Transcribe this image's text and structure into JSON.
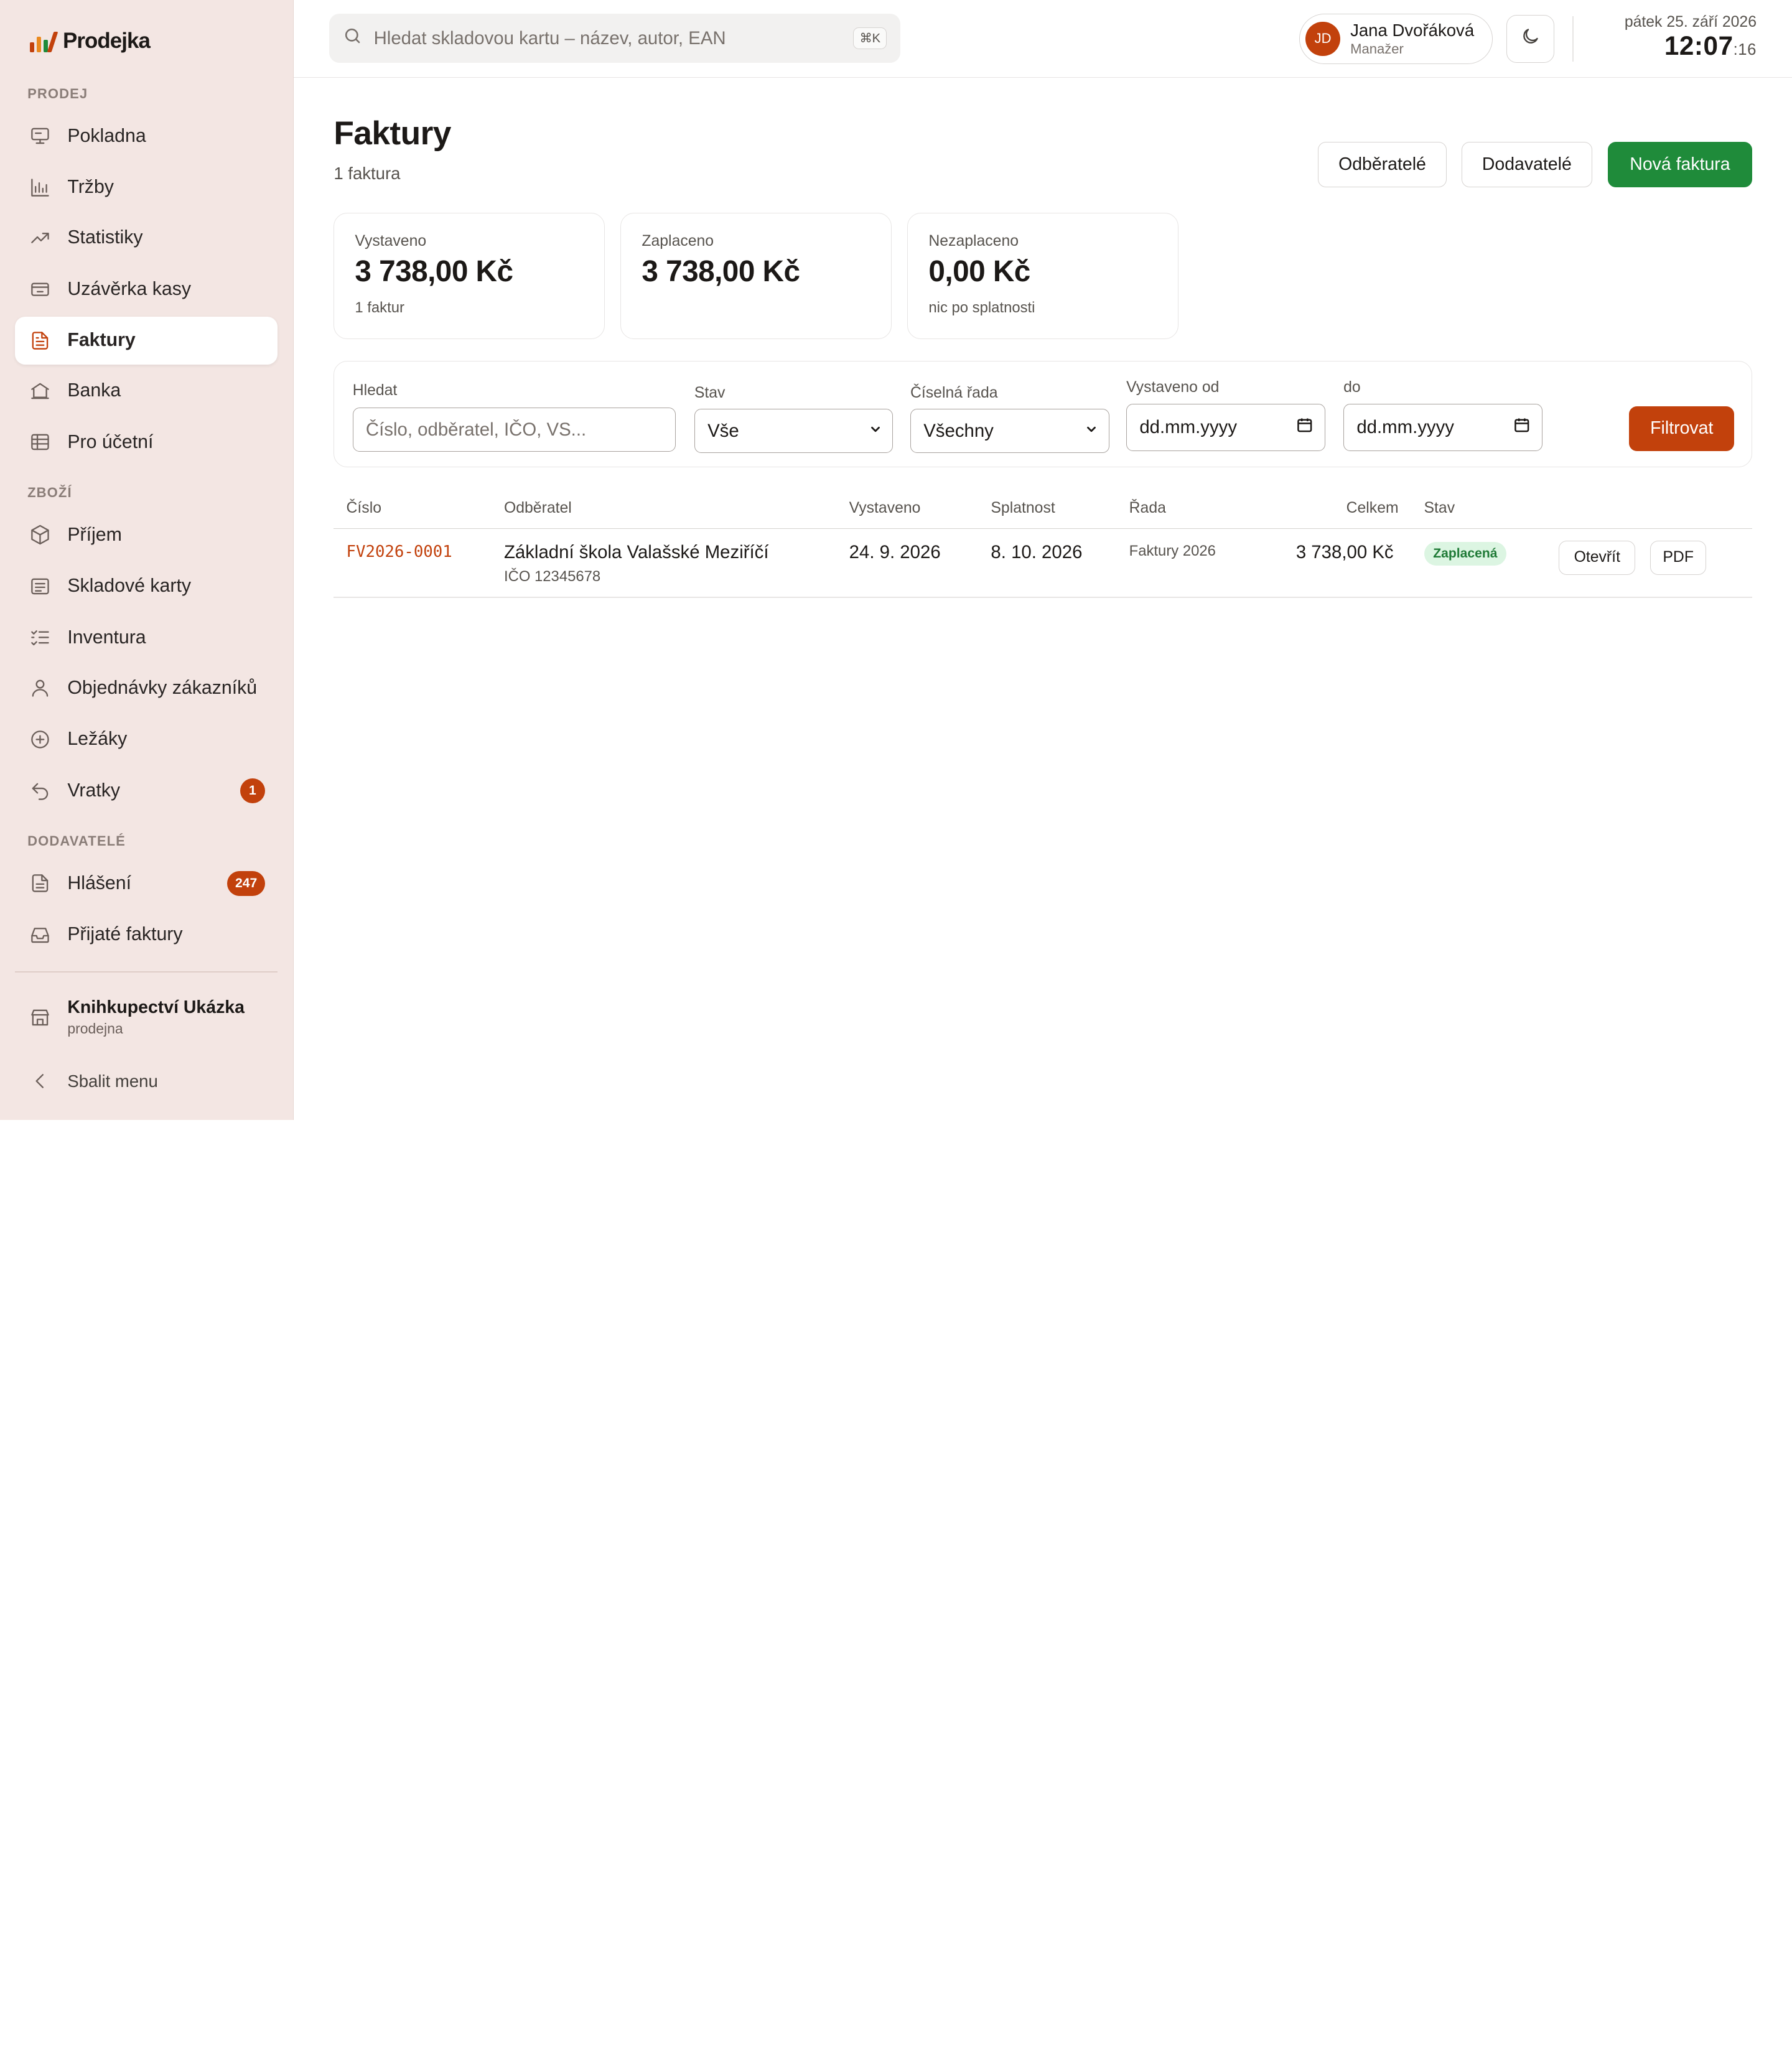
{
  "brand": {
    "name": "Prodejka",
    "colors": {
      "accent": "#c2410c",
      "primary_green": "#1f8b3a",
      "sidebar_bg": "#f3e6e3"
    }
  },
  "sidebar": {
    "sections": {
      "prodej": "PRODEJ",
      "zbozi": "ZBOŽÍ",
      "dodavatele": "DODAVATELÉ"
    },
    "items": [
      {
        "label": "Pokladna",
        "icon": "monitor-icon"
      },
      {
        "label": "Tržby",
        "icon": "bar-chart-icon"
      },
      {
        "label": "Statistiky",
        "icon": "trend-icon"
      },
      {
        "label": "Uzávěrka kasy",
        "icon": "cash-register-icon"
      },
      {
        "label": "Faktury",
        "icon": "invoice-icon",
        "active": true
      },
      {
        "label": "Banka",
        "icon": "bank-icon"
      },
      {
        "label": "Pro účetní",
        "icon": "table-icon"
      },
      {
        "label": "Příjem",
        "icon": "box-icon"
      },
      {
        "label": "Skladové karty",
        "icon": "card-list-icon"
      },
      {
        "label": "Inventura",
        "icon": "checklist-icon"
      },
      {
        "label": "Objednávky zákazníků",
        "icon": "user-icon"
      },
      {
        "label": "Ležáky",
        "icon": "plus-circle-icon"
      },
      {
        "label": "Vratky",
        "icon": "undo-icon",
        "badge": "1"
      },
      {
        "label": "Hlášení",
        "icon": "document-icon",
        "badge": "247"
      },
      {
        "label": "Přijaté faktury",
        "icon": "inbox-icon"
      }
    ],
    "store": {
      "name": "Knihkupectví Ukázka",
      "type": "prodejna",
      "icon": "store-icon"
    },
    "collapse_label": "Sbalit menu"
  },
  "topbar": {
    "search_placeholder": "Hledat skladovou kartu – název, autor, EAN",
    "search_shortcut": "⌘K",
    "user": {
      "initials": "JD",
      "name": "Jana Dvořáková",
      "role": "Manažer"
    },
    "date": "pátek 25. září 2026",
    "time": "12:07",
    "seconds": ":16"
  },
  "page": {
    "title": "Faktury",
    "subtitle": "1 faktura",
    "buttons": {
      "customers": "Odběratelé",
      "suppliers": "Dodavatelé",
      "new_invoice": "Nová faktura"
    }
  },
  "stats": [
    {
      "label": "Vystaveno",
      "value": "3 738,00 Kč",
      "note": "1 faktur"
    },
    {
      "label": "Zaplaceno",
      "value": "3 738,00 Kč",
      "note": ""
    },
    {
      "label": "Nezaplaceno",
      "value": "0,00 Kč",
      "note": "nic po splatnosti"
    }
  ],
  "filters": {
    "search_label": "Hledat",
    "search_placeholder": "Číslo, odběratel, IČO, VS...",
    "status_label": "Stav",
    "status_value": "Vše",
    "series_label": "Číselná řada",
    "series_value": "Všechny",
    "from_label": "Vystaveno od",
    "from_value": "dd.mm.yyyy",
    "to_label": "do",
    "to_value": "dd.mm.yyyy",
    "submit": "Filtrovat"
  },
  "table": {
    "columns": [
      "Číslo",
      "Odběratel",
      "Vystaveno",
      "Splatnost",
      "Řada",
      "Celkem",
      "Stav"
    ],
    "rows": [
      {
        "number": "FV2026-0001",
        "customer": "Základní škola Valašské Meziříčí",
        "customer_ico": "IČO 12345678",
        "issued": "24. 9. 2026",
        "due": "8. 10. 2026",
        "series": "Faktury 2026",
        "total": "3 738,00 Kč",
        "status": "Zaplacená",
        "actions": {
          "open": "Otevřít",
          "pdf": "PDF"
        }
      }
    ]
  }
}
